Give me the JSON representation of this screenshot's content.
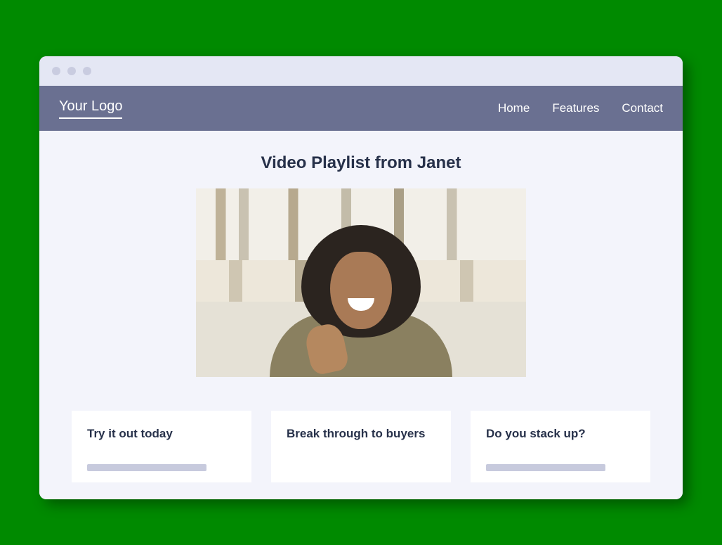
{
  "header": {
    "logo": "Your Logo",
    "nav": [
      "Home",
      "Features",
      "Contact"
    ]
  },
  "main": {
    "title": "Video Playlist from Janet"
  },
  "cards": [
    {
      "title": "Try it out today"
    },
    {
      "title": "Break through to buyers"
    },
    {
      "title": "Do you stack up?"
    }
  ]
}
